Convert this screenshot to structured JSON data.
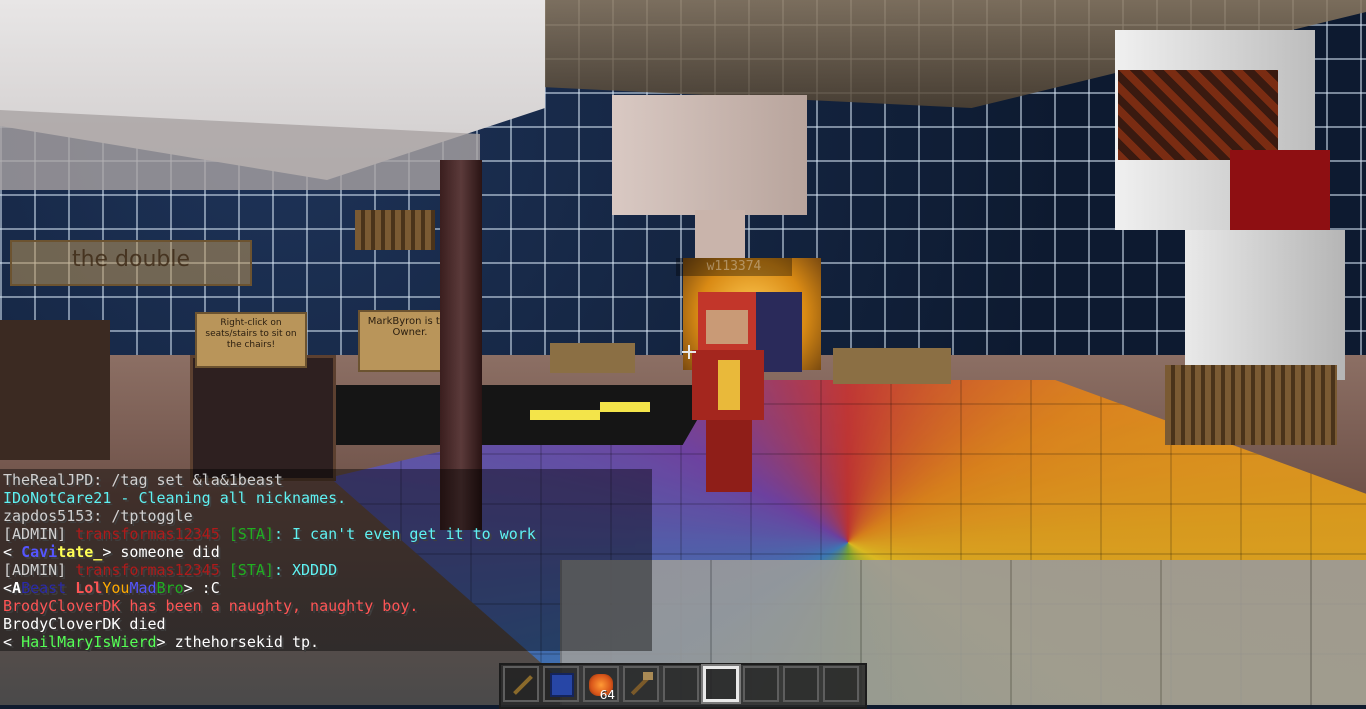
{
  "world": {
    "nametag": "w113374",
    "signs": [
      {
        "text": "MarkByron is the Owner."
      },
      {
        "text": "Right-click on seats/stairs to sit on the chairs!"
      },
      {
        "text": "the double"
      }
    ]
  },
  "chat": {
    "lines": [
      {
        "segments": [
          {
            "text": "TheRealJPD: /tag set &la&1beast",
            "color": "gray"
          }
        ]
      },
      {
        "segments": [
          {
            "text": "IDoNotCare21 - Cleaning all nicknames.",
            "color": "aqua"
          }
        ]
      },
      {
        "segments": [
          {
            "text": "zapdos5153: /tptoggle",
            "color": "gray"
          }
        ]
      },
      {
        "segments": [
          {
            "text": "[ADMIN] ",
            "color": "gray"
          },
          {
            "text": "transformas12345 ",
            "color": "dred"
          },
          {
            "text": "[STA]",
            "color": "dgreen"
          },
          {
            "text": ": I can't even get it to work",
            "color": "aqua"
          }
        ]
      },
      {
        "segments": [
          {
            "text": "< ",
            "color": "white"
          },
          {
            "text": "Cavi",
            "color": "blue",
            "bold": true
          },
          {
            "text": "tate_",
            "color": "yellow",
            "bold": true
          },
          {
            "text": "> someone did",
            "color": "white"
          }
        ]
      },
      {
        "segments": [
          {
            "text": "[ADMIN] ",
            "color": "gray"
          },
          {
            "text": "transformas12345 ",
            "color": "dred"
          },
          {
            "text": "[STA]",
            "color": "dgreen"
          },
          {
            "text": ": XDDDD",
            "color": "aqua"
          }
        ]
      },
      {
        "segments": [
          {
            "text": "<",
            "color": "white"
          },
          {
            "text": "A",
            "color": "white",
            "bold": true
          },
          {
            "text": "Beast ",
            "color": "dblue"
          },
          {
            "text": "Lol",
            "color": "red",
            "bold": true
          },
          {
            "text": "You",
            "color": "gold"
          },
          {
            "text": "Mad",
            "color": "blue"
          },
          {
            "text": "Bro",
            "color": "dgreen"
          },
          {
            "text": "> :C",
            "color": "white"
          }
        ]
      },
      {
        "segments": [
          {
            "text": "BrodyCloverDK has been a naughty, naughty boy.",
            "color": "red"
          }
        ]
      },
      {
        "segments": [
          {
            "text": "BrodyCloverDK died",
            "color": "white"
          }
        ]
      },
      {
        "segments": [
          {
            "text": "< ",
            "color": "white"
          },
          {
            "text": "HailMaryIsWierd",
            "color": "green"
          },
          {
            "text": "> zthehorsekid tp.",
            "color": "white"
          }
        ]
      }
    ]
  },
  "hotbar": {
    "selected_slot": 6,
    "slots": [
      {
        "item": "stick",
        "count": ""
      },
      {
        "item": "blue-wool",
        "count": ""
      },
      {
        "item": "cooked-food",
        "count": "64"
      },
      {
        "item": "wooden-hoe",
        "count": ""
      },
      {
        "item": "",
        "count": ""
      },
      {
        "item": "",
        "count": ""
      },
      {
        "item": "",
        "count": ""
      },
      {
        "item": "",
        "count": ""
      },
      {
        "item": "",
        "count": ""
      }
    ]
  },
  "colors": {
    "chat_background": "#000000",
    "selected_slot_border": "#eaeaea"
  }
}
